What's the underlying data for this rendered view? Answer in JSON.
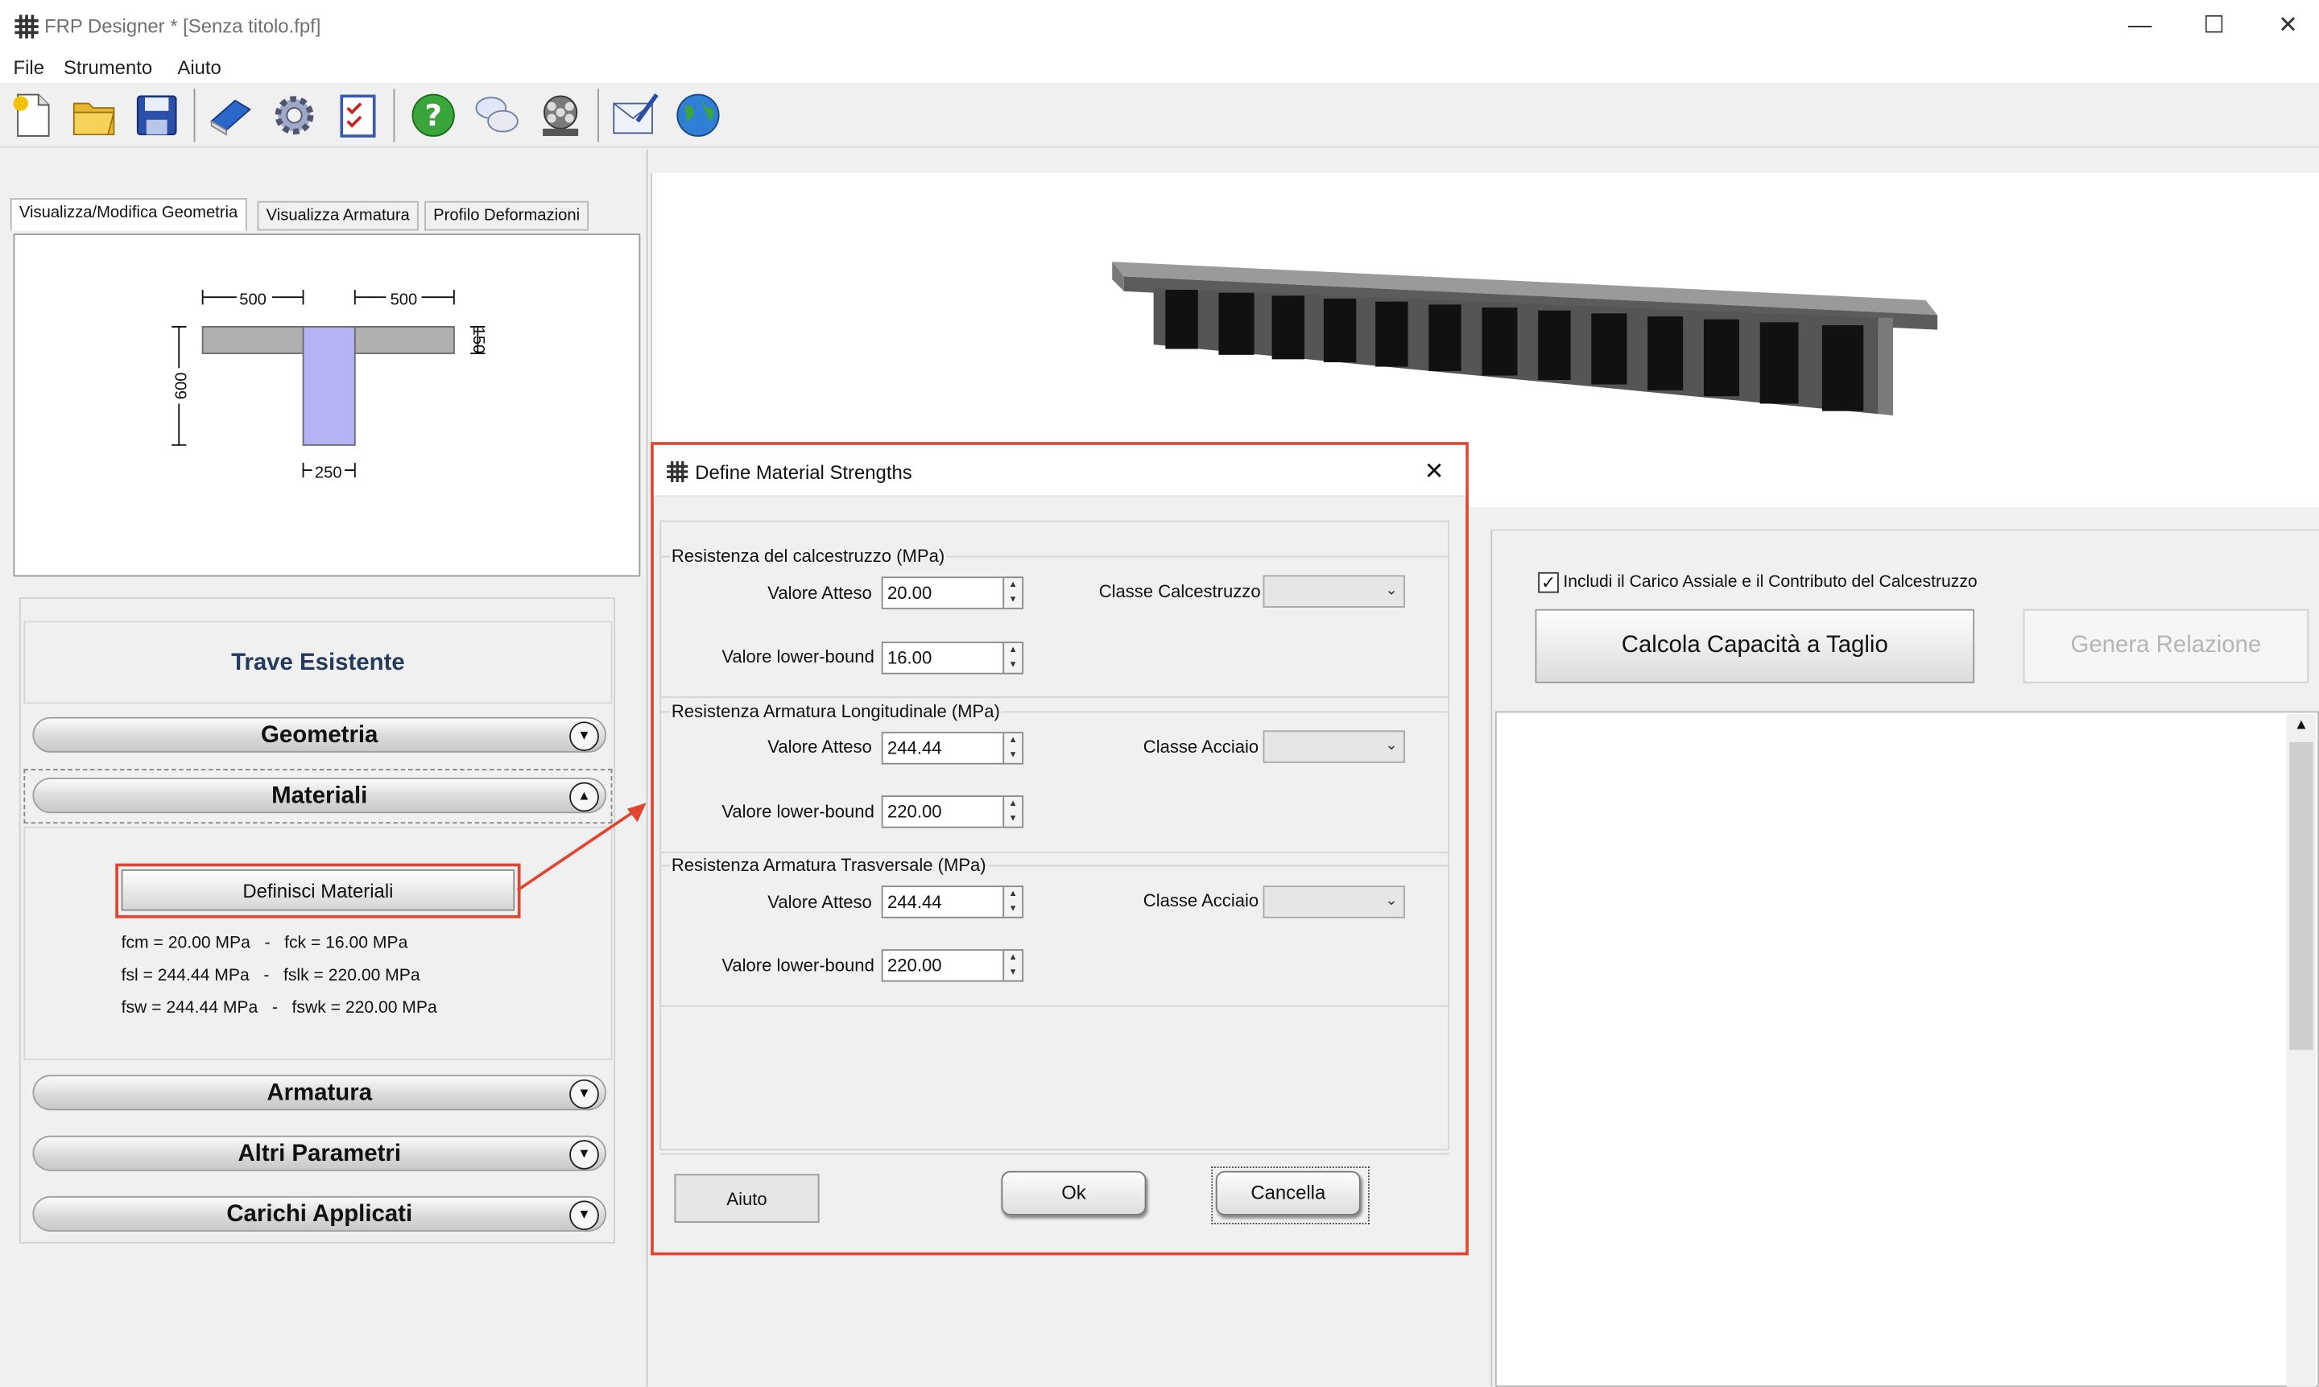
{
  "window": {
    "title": "FRP Designer * [Senza titolo.fpf]"
  },
  "menu": [
    "File",
    "Strumento",
    "Aiuto"
  ],
  "toolbar_icons": [
    "new-document-icon",
    "open-folder-icon",
    "save-icon",
    "manual-book-icon",
    "settings-gear-icon",
    "checklist-icon",
    "help-icon",
    "chat-bubbles-icon",
    "film-reel-icon",
    "email-icon",
    "globe-icon"
  ],
  "tabs": [
    "Visualizza/Modifica Geometria",
    "Visualizza Armatura",
    "Profilo Deformazioni"
  ],
  "section": {
    "b_left": "500",
    "b_right": "500",
    "h": "600",
    "hf": "150",
    "bw": "250"
  },
  "panel": {
    "heading": "Trave Esistente",
    "geometria": "Geometria",
    "materiali": "Materiali",
    "define_button": "Definisci Materiali",
    "summary": [
      "fcm = 20.00 MPa   -   fck = 16.00 MPa",
      "fsl = 244.44 MPa   -   fslk = 220.00 MPa",
      "fsw = 244.44 MPa   -   fswk = 220.00 MPa"
    ],
    "armatura": "Armatura",
    "altri": "Altri Parametri",
    "carichi": "Carichi Applicati"
  },
  "right": {
    "checkbox_label": "Includi il Carico Assiale e il Contributo del Calcestruzzo",
    "checkbox_checked": true,
    "calc_button": "Calcola Capacità a Taglio",
    "report_button": "Genera Relazione"
  },
  "dialog": {
    "title": "Define Material Strengths",
    "groups": [
      {
        "title": "Resistenza del calcestruzzo (MPa)",
        "expected_label": "Valore Atteso",
        "expected": "20.00",
        "lower_label": "Valore lower-bound",
        "lower": "16.00",
        "class_label": "Classe Calcestruzzo"
      },
      {
        "title": "Resistenza Armatura Longitudinale (MPa)",
        "expected_label": "Valore Atteso",
        "expected": "244.44",
        "lower_label": "Valore lower-bound",
        "lower": "220.00",
        "class_label": "Classe Acciaio"
      },
      {
        "title": "Resistenza Armatura Trasversale (MPa)",
        "expected_label": "Valore Atteso",
        "expected": "244.44",
        "lower_label": "Valore lower-bound",
        "lower": "220.00",
        "class_label": "Classe Acciaio"
      }
    ],
    "help": "Aiuto",
    "ok": "Ok",
    "cancel": "Cancella"
  },
  "colors": {
    "highlight": "#e0452f",
    "web_fill": "#b4b4f4",
    "flange_fill": "#b0b0b0"
  }
}
